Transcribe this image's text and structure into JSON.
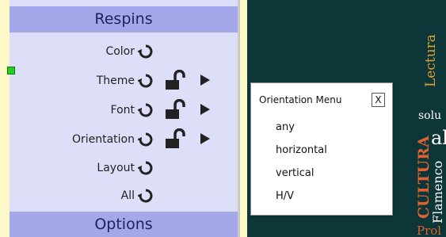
{
  "respins": {
    "header": "Respins",
    "rows": {
      "color": "Color",
      "theme": "Theme",
      "font": "Font",
      "orientation": "Orientation",
      "layout": "Layout",
      "all": "All"
    }
  },
  "options": {
    "header": "Options"
  },
  "icons": {
    "respin": "refresh-icon",
    "lock": "unlock-icon",
    "expand": "play-arrow-icon"
  },
  "colors": {
    "page_bg": "#fdf8c8",
    "panel_bg": "#dddef8",
    "header_bg": "#a4a8ea",
    "canvas_bg": "#0c3638"
  },
  "orientation_menu": {
    "title": "Orientation Menu",
    "close": "X",
    "items": [
      "any",
      "horizontal",
      "vertical",
      "H/V"
    ]
  },
  "word_cloud": {
    "words": [
      "Lectura",
      "solu",
      "al",
      "CULTURA",
      "Flamenco",
      "Prol"
    ]
  }
}
